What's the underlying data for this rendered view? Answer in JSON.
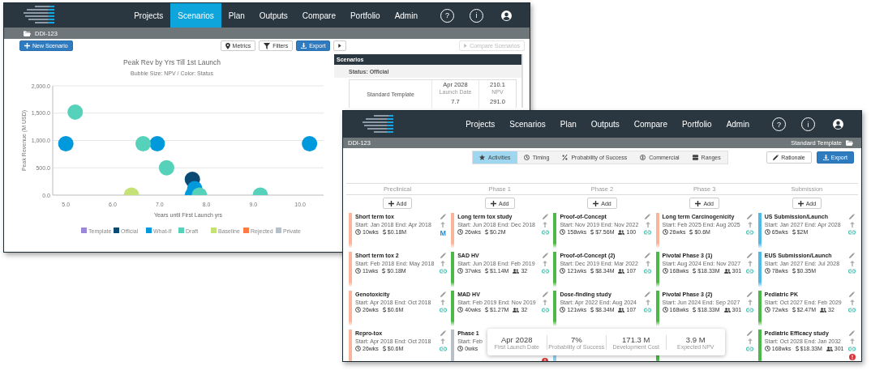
{
  "back_window": {
    "nav": {
      "items": [
        {
          "label": "Projects",
          "selected": false
        },
        {
          "label": "Scenarios",
          "selected": true
        },
        {
          "label": "Plan",
          "selected": false
        },
        {
          "label": "Outputs",
          "selected": false
        },
        {
          "label": "Compare",
          "selected": false
        },
        {
          "label": "Portfolio",
          "selected": false
        },
        {
          "label": "Admin",
          "selected": false
        }
      ],
      "help": "?",
      "info": "i"
    },
    "breadcrumb": {
      "project": "DDI-123"
    },
    "toolbar": {
      "new_button": "New Scenario",
      "metrics_button": "Metrics",
      "filters_button": "Filters",
      "export_button": "Export",
      "compare_button": {
        "label": "Compare Scenarios",
        "disabled": true
      }
    },
    "chart": {
      "subtitle": "Bubble Size: NPV / Color: Status",
      "chart_data": {
        "type": "scatter",
        "grid": true,
        "legend": "bottom",
        "title": "Peak Rev by Yrs Till 1st Launch",
        "xlabel": "Years until First Launch yrs",
        "ylabel": "Peak Revenue (M USD)",
        "xlim": [
          4.72,
          10.5
        ],
        "ylim": [
          0,
          2000
        ],
        "xticks": [
          {
            "value": 5,
            "label": "5.0"
          },
          {
            "value": 6,
            "label": "6.0"
          },
          {
            "value": 7,
            "label": "7.0"
          },
          {
            "value": 8,
            "label": "8.0"
          },
          {
            "value": 9,
            "label": "9.0"
          },
          {
            "value": 10,
            "label": "10.0"
          }
        ],
        "yticks": [
          {
            "value": 0,
            "label": "0.0"
          },
          {
            "value": 500,
            "label": "500.0"
          },
          {
            "value": 1000,
            "label": "1,000.0"
          },
          {
            "value": 1500,
            "label": "1,500.0"
          },
          {
            "value": 2000,
            "label": "2,000.0"
          }
        ],
        "series": [
          {
            "name": "Template",
            "color": "#9b86d8"
          },
          {
            "name": "Official",
            "color": "#0b4a75",
            "x": [
              7.7
            ],
            "values": [
              290
            ]
          },
          {
            "name": "What-If",
            "color": "#0099db",
            "x": [
              5.0,
              6.95,
              10.2,
              7.75,
              7.7
            ],
            "values": [
              940,
              940,
              940,
              120,
              0
            ]
          },
          {
            "name": "Draft",
            "color": "#56d1ba",
            "x": [
              5.2,
              6.65,
              7.15,
              7.85,
              9.15
            ],
            "values": [
              1520,
              940,
              500,
              0,
              0
            ]
          },
          {
            "name": "Baseline",
            "color": "#c4e275",
            "x": [
              6.4
            ],
            "values": [
              0
            ]
          },
          {
            "name": "Rejected",
            "color": "#ff7a45"
          },
          {
            "name": "Private",
            "color": "#b5c0c8"
          }
        ]
      }
    },
    "scenarios_panel": {
      "title": "Scenarios",
      "group": "Status: Official",
      "card": {
        "name": "Standard Template",
        "metrics": [
          {
            "value": "Apr 2028",
            "label": "Launch Date"
          },
          {
            "value": "210.1",
            "label": "NPV"
          },
          {
            "value": "7.7"
          },
          {
            "value": "291.0"
          }
        ]
      }
    }
  },
  "front_window": {
    "nav": {
      "items": [
        {
          "label": "Projects",
          "selected": false
        },
        {
          "label": "Scenarios",
          "selected": false
        },
        {
          "label": "Plan",
          "selected": false
        },
        {
          "label": "Outputs",
          "selected": false
        },
        {
          "label": "Compare",
          "selected": false
        },
        {
          "label": "Portfolio",
          "selected": false
        },
        {
          "label": "Admin",
          "selected": false
        }
      ],
      "help": "?",
      "info": "i"
    },
    "breadcrumb": {
      "project": "DDI-123",
      "template": "Standard Template"
    },
    "tabs": [
      {
        "label": "Activities",
        "selected": true
      },
      {
        "label": "Timing",
        "selected": false
      },
      {
        "label": "Probability of Success",
        "selected": false
      },
      {
        "label": "Commercial",
        "selected": false
      },
      {
        "label": "Ranges",
        "selected": false
      }
    ],
    "buttons": [
      {
        "label": "Rationale",
        "primary": false
      },
      {
        "label": "Export",
        "primary": true
      }
    ],
    "columns": [
      {
        "title": "Preclinical",
        "add": "Add",
        "cards": [
          {
            "name": "Short term tox",
            "dates": "Start: Jan 2018 End: Apr 2018",
            "duration": "10wks",
            "cost": "$0.18M",
            "color": "#f9b59a",
            "editable": true,
            "tag": "M"
          },
          {
            "name": "Short term tox 2",
            "dates": "Start: Feb 2018 End: May 2018",
            "duration": "11wks",
            "cost": "$0.18M",
            "color": "#f9b59a",
            "editable": true,
            "linked": true
          },
          {
            "name": "Genotoxicity",
            "dates": "Start: Apr 2018 End: Oct 2018",
            "duration": "26wks",
            "cost": "$0.6M",
            "color": "#f9b59a",
            "editable": true,
            "linked": true
          },
          {
            "name": "Repro-tox",
            "dates": "Start: Apr 2018 End: Oct 2018",
            "duration": "26wks",
            "cost": "$0.6M",
            "color": "#f9b59a",
            "editable": true,
            "linked": true
          }
        ]
      },
      {
        "title": "Phase 1",
        "add": "Add",
        "cards": [
          {
            "name": "Long term tox study",
            "dates": "Start: Jun 2018 End: Dec 2018",
            "duration": "26wks",
            "cost": "$0.2M",
            "color": "#f9b59a",
            "editable": true,
            "linked": true
          },
          {
            "name": "SAD HV",
            "dates": "Start: Jun 2018 End: Feb 2019",
            "duration": "37wks",
            "cost": "$1.14M",
            "patients": "32",
            "color": "#4cb848",
            "editable": true,
            "linked": true
          },
          {
            "name": "MAD HV",
            "dates": "Start: Feb 2019 End: Nov 2019",
            "duration": "40wks",
            "cost": "$1.27M",
            "patients": "32",
            "color": "#4cb848",
            "editable": true,
            "linked": true
          },
          {
            "name": "Phase 1",
            "dates": "Start: Feb",
            "duration": "0wks",
            "color": "#b9bfc4",
            "alert": true
          }
        ]
      },
      {
        "title": "Phase 2",
        "add": "Add",
        "cards": [
          {
            "name": "Proof-of-Concept",
            "dates": "Start: Nov 2019 End: Nov 2022",
            "duration": "158wks",
            "cost": "$7.56M",
            "patients": "100",
            "color": "#4cb848",
            "editable": true,
            "linked": true
          },
          {
            "name": "Proof-of-Concept (2)",
            "dates": "Start: Dec 2019 End: Mar 2022",
            "duration": "121wks",
            "cost": "$8.34M",
            "patients": "107",
            "color": "#4cb848",
            "editable": true,
            "linked": true
          },
          {
            "name": "Dose-finding study",
            "dates": "Start: Apr 2022 End: Aug 2024",
            "duration": "121wks",
            "cost": "$8.34M",
            "patients": "107",
            "color": "#4cb848",
            "editable": true,
            "linked": true
          },
          {
            "color": "#8fd0ec"
          }
        ]
      },
      {
        "title": "Phase 3",
        "add": "Add",
        "cards": [
          {
            "name": "Long term Carcinogenicity",
            "dates": "Start: Feb 2025 End: Aug 2025",
            "duration": "26wks",
            "cost": "$0.6M",
            "color": "#f9b59a",
            "editable": true,
            "linked": true
          },
          {
            "name": "Pivotal Phase 3 (1)",
            "dates": "Start: Aug 2024 End: Nov 2027",
            "duration": "168wks",
            "cost": "$18.33M",
            "patients": "301",
            "color": "#4cb848",
            "editable": true,
            "linked": true
          },
          {
            "name": "Pivotal Phase 3 (2)",
            "dates": "Start: Jun 2024 End: Sep 2027",
            "duration": "168wks",
            "cost": "$18.33M",
            "patients": "301",
            "color": "#4cb848",
            "editable": true,
            "linked": true
          },
          {
            "color": "#4cb848",
            "editable": true,
            "linked": true
          }
        ]
      },
      {
        "title": "Submission",
        "add": "Add",
        "cards": [
          {
            "name": "US Submission/Launch",
            "dates": "Start: Jan 2027 End: Apr 2028",
            "duration": "65wks",
            "cost": "$2M",
            "color": "#4fb9e8",
            "editable": true,
            "linked": true
          },
          {
            "name": "EUS Submission/Launch",
            "dates": "Start: Jan 2027 End: Jul 2028",
            "duration": "78wks",
            "cost": "$0.35M",
            "color": "#4fb9e8",
            "editable": true,
            "linked": true
          },
          {
            "name": "Pediatric PK",
            "dates": "Start: Oct 2027 End: Feb 2029",
            "duration": "72wks",
            "cost": "$2.47M",
            "patients": "32",
            "color": "#4cb848",
            "editable": true,
            "linked": true
          },
          {
            "name": "Pediatric Efficacy study",
            "dates": "Start: Oct 2028 End: Jan 2032",
            "duration": "168wks",
            "cost": "$18.33M",
            "patients": "301",
            "color": "#4cb848",
            "editable": true,
            "linked": true,
            "alert": true
          }
        ]
      }
    ],
    "summary": [
      {
        "value": "Apr 2028",
        "label": "First Launch Date"
      },
      {
        "value": "7%",
        "label": "Probability of Success"
      },
      {
        "value": "171.3 M",
        "label": "Development Cost"
      },
      {
        "value": "3.9 M",
        "label": "Expected NPV"
      }
    ]
  }
}
